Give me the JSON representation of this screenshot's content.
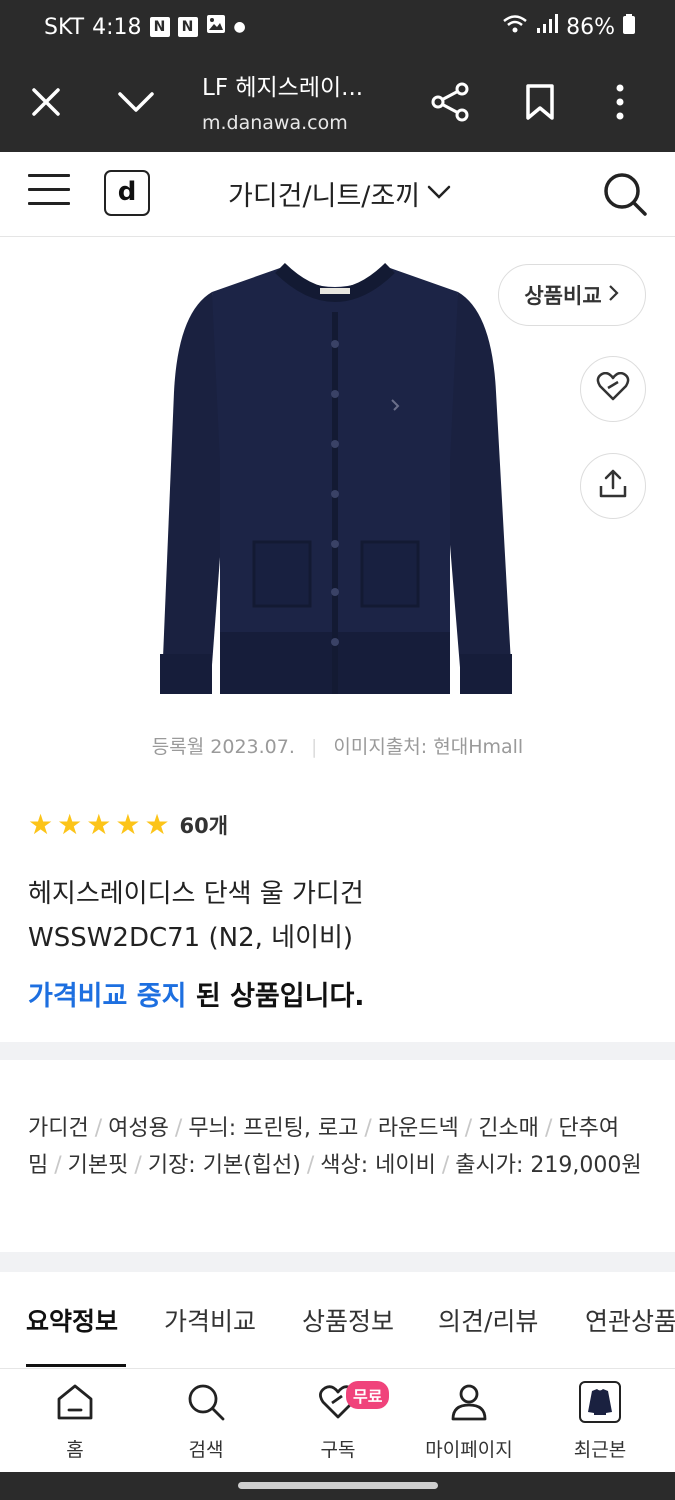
{
  "status": {
    "carrier": "SKT",
    "time": "4:18",
    "battery": "86%"
  },
  "browser": {
    "title": "LF 헤지스레이...",
    "url": "m.danawa.com"
  },
  "header": {
    "logo": "d",
    "category": "가디건/니트/조끼"
  },
  "product": {
    "compare_label": "상품비교",
    "registered": "등록월 2023.07.",
    "image_source": "이미지출처: 현대Hmall",
    "rating_stars": 5,
    "review_count": "60개",
    "title_line1": "헤지스레이디스 단색 울 가디건",
    "title_line2": "WSSW2DC71 (N2, 네이비)",
    "status_highlight": "가격비교 중지",
    "status_rest": " 된 상품입니다."
  },
  "specs": [
    "가디건",
    "여성용",
    "무늬: 프린팅, 로고",
    "라운드넥",
    "긴소매",
    "단추여밈",
    "기본핏",
    "기장: 기본(힙선)",
    "색상: 네이비",
    "출시가: 219,000원"
  ],
  "tabs": [
    "요약정보",
    "가격비교",
    "상품정보",
    "의견/리뷰",
    "연관상품"
  ],
  "bottom_nav": [
    {
      "label": "홈",
      "icon": "home-icon"
    },
    {
      "label": "검색",
      "icon": "search-icon"
    },
    {
      "label": "구독",
      "icon": "heart-subscribe-icon",
      "badge": "무료"
    },
    {
      "label": "마이페이지",
      "icon": "person-icon"
    },
    {
      "label": "최근본",
      "icon": "recent-product-thumbnail"
    }
  ],
  "colors": {
    "accent_blue": "#1d6fe0",
    "star": "#fcc419",
    "badge_pink": "#f0437b",
    "cardigan_navy": "#1a2140"
  }
}
